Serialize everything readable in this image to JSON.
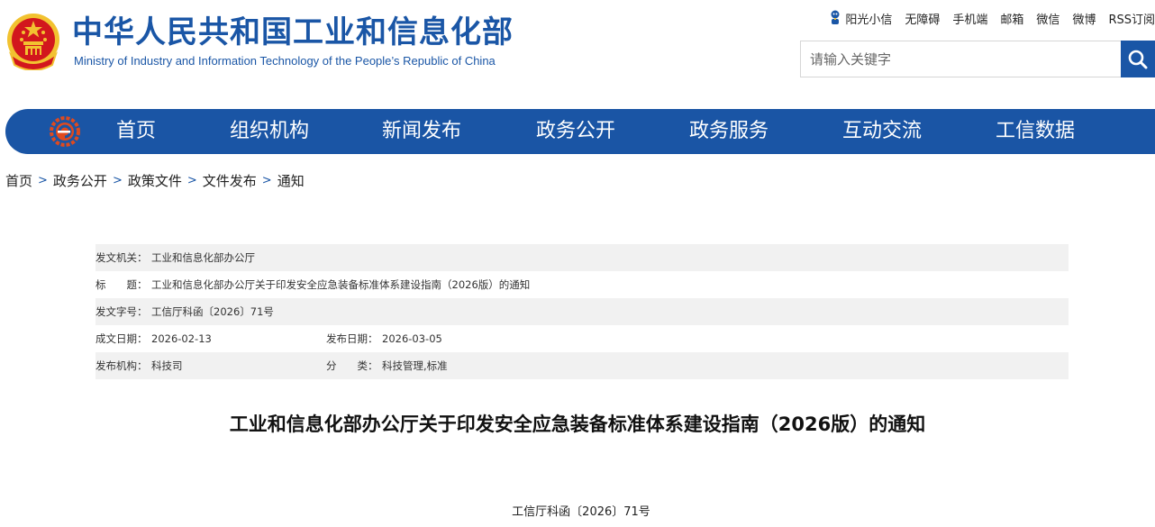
{
  "header": {
    "title": "中华人民共和国工业和信息化部",
    "subtitle": "Ministry of Industry and Information Technology of the People’s Republic of China",
    "top_links": [
      "阳光小信",
      "无障碍",
      "手机端",
      "邮箱",
      "微信",
      "微博",
      "RSS订阅"
    ],
    "search_placeholder": "请输入关键字"
  },
  "nav": {
    "items": [
      "首页",
      "组织机构",
      "新闻发布",
      "政务公开",
      "政务服务",
      "互动交流",
      "工信数据"
    ]
  },
  "breadcrumb": [
    "首页",
    "政务公开",
    "政策文件",
    "文件发布",
    "通知"
  ],
  "info": {
    "issuer_label": "发文机关：",
    "issuer": "工业和信息化部办公厅",
    "title_label": "标　　题：",
    "title": "工业和信息化部办公厅关于印发安全应急装备标准体系建设指南（2026版）的通知",
    "doc_no_label": "发文字号：",
    "doc_no": "工信厅科函〔2026〕71号",
    "created_label": "成文日期：",
    "created": "2026-02-13",
    "published_label": "发布日期：",
    "published": "2026-03-05",
    "org_label": "发布机构：",
    "org": "科技司",
    "category_label": "分　　类：",
    "category": "科技管理,标准"
  },
  "document": {
    "title": "工业和信息化部办公厅关于印发安全应急装备标准体系建设指南（2026版）的通知",
    "number": "工信厅科函〔2026〕71号"
  },
  "colors": {
    "brand": "#1a56a6",
    "nav_bg": "#1a55a5",
    "emblem_red": "#d2171d",
    "emblem_gold": "#f2c230"
  },
  "icons": {
    "emblem": "national-emblem-icon",
    "robot": "robot-icon",
    "search": "search-icon",
    "nav_logo": "miit-logo-icon"
  }
}
